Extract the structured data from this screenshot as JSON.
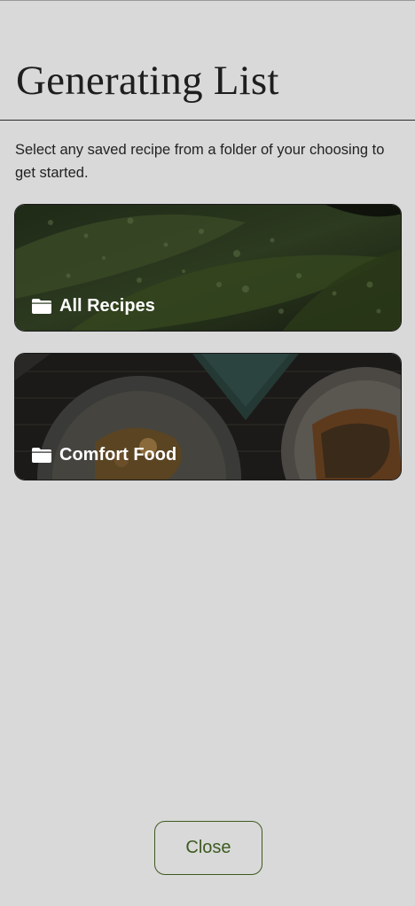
{
  "header": {
    "title": "Generating List"
  },
  "description": "Select any saved recipe from a folder of your choosing to get started.",
  "folders": [
    {
      "label": "All Recipes",
      "icon": "folder-icon"
    },
    {
      "label": "Comfort Food",
      "icon": "folder-icon"
    }
  ],
  "footer": {
    "close_label": "Close"
  },
  "colors": {
    "background": "#d9d9d9",
    "accent": "#3d5a20",
    "text": "#1e1e1e"
  }
}
